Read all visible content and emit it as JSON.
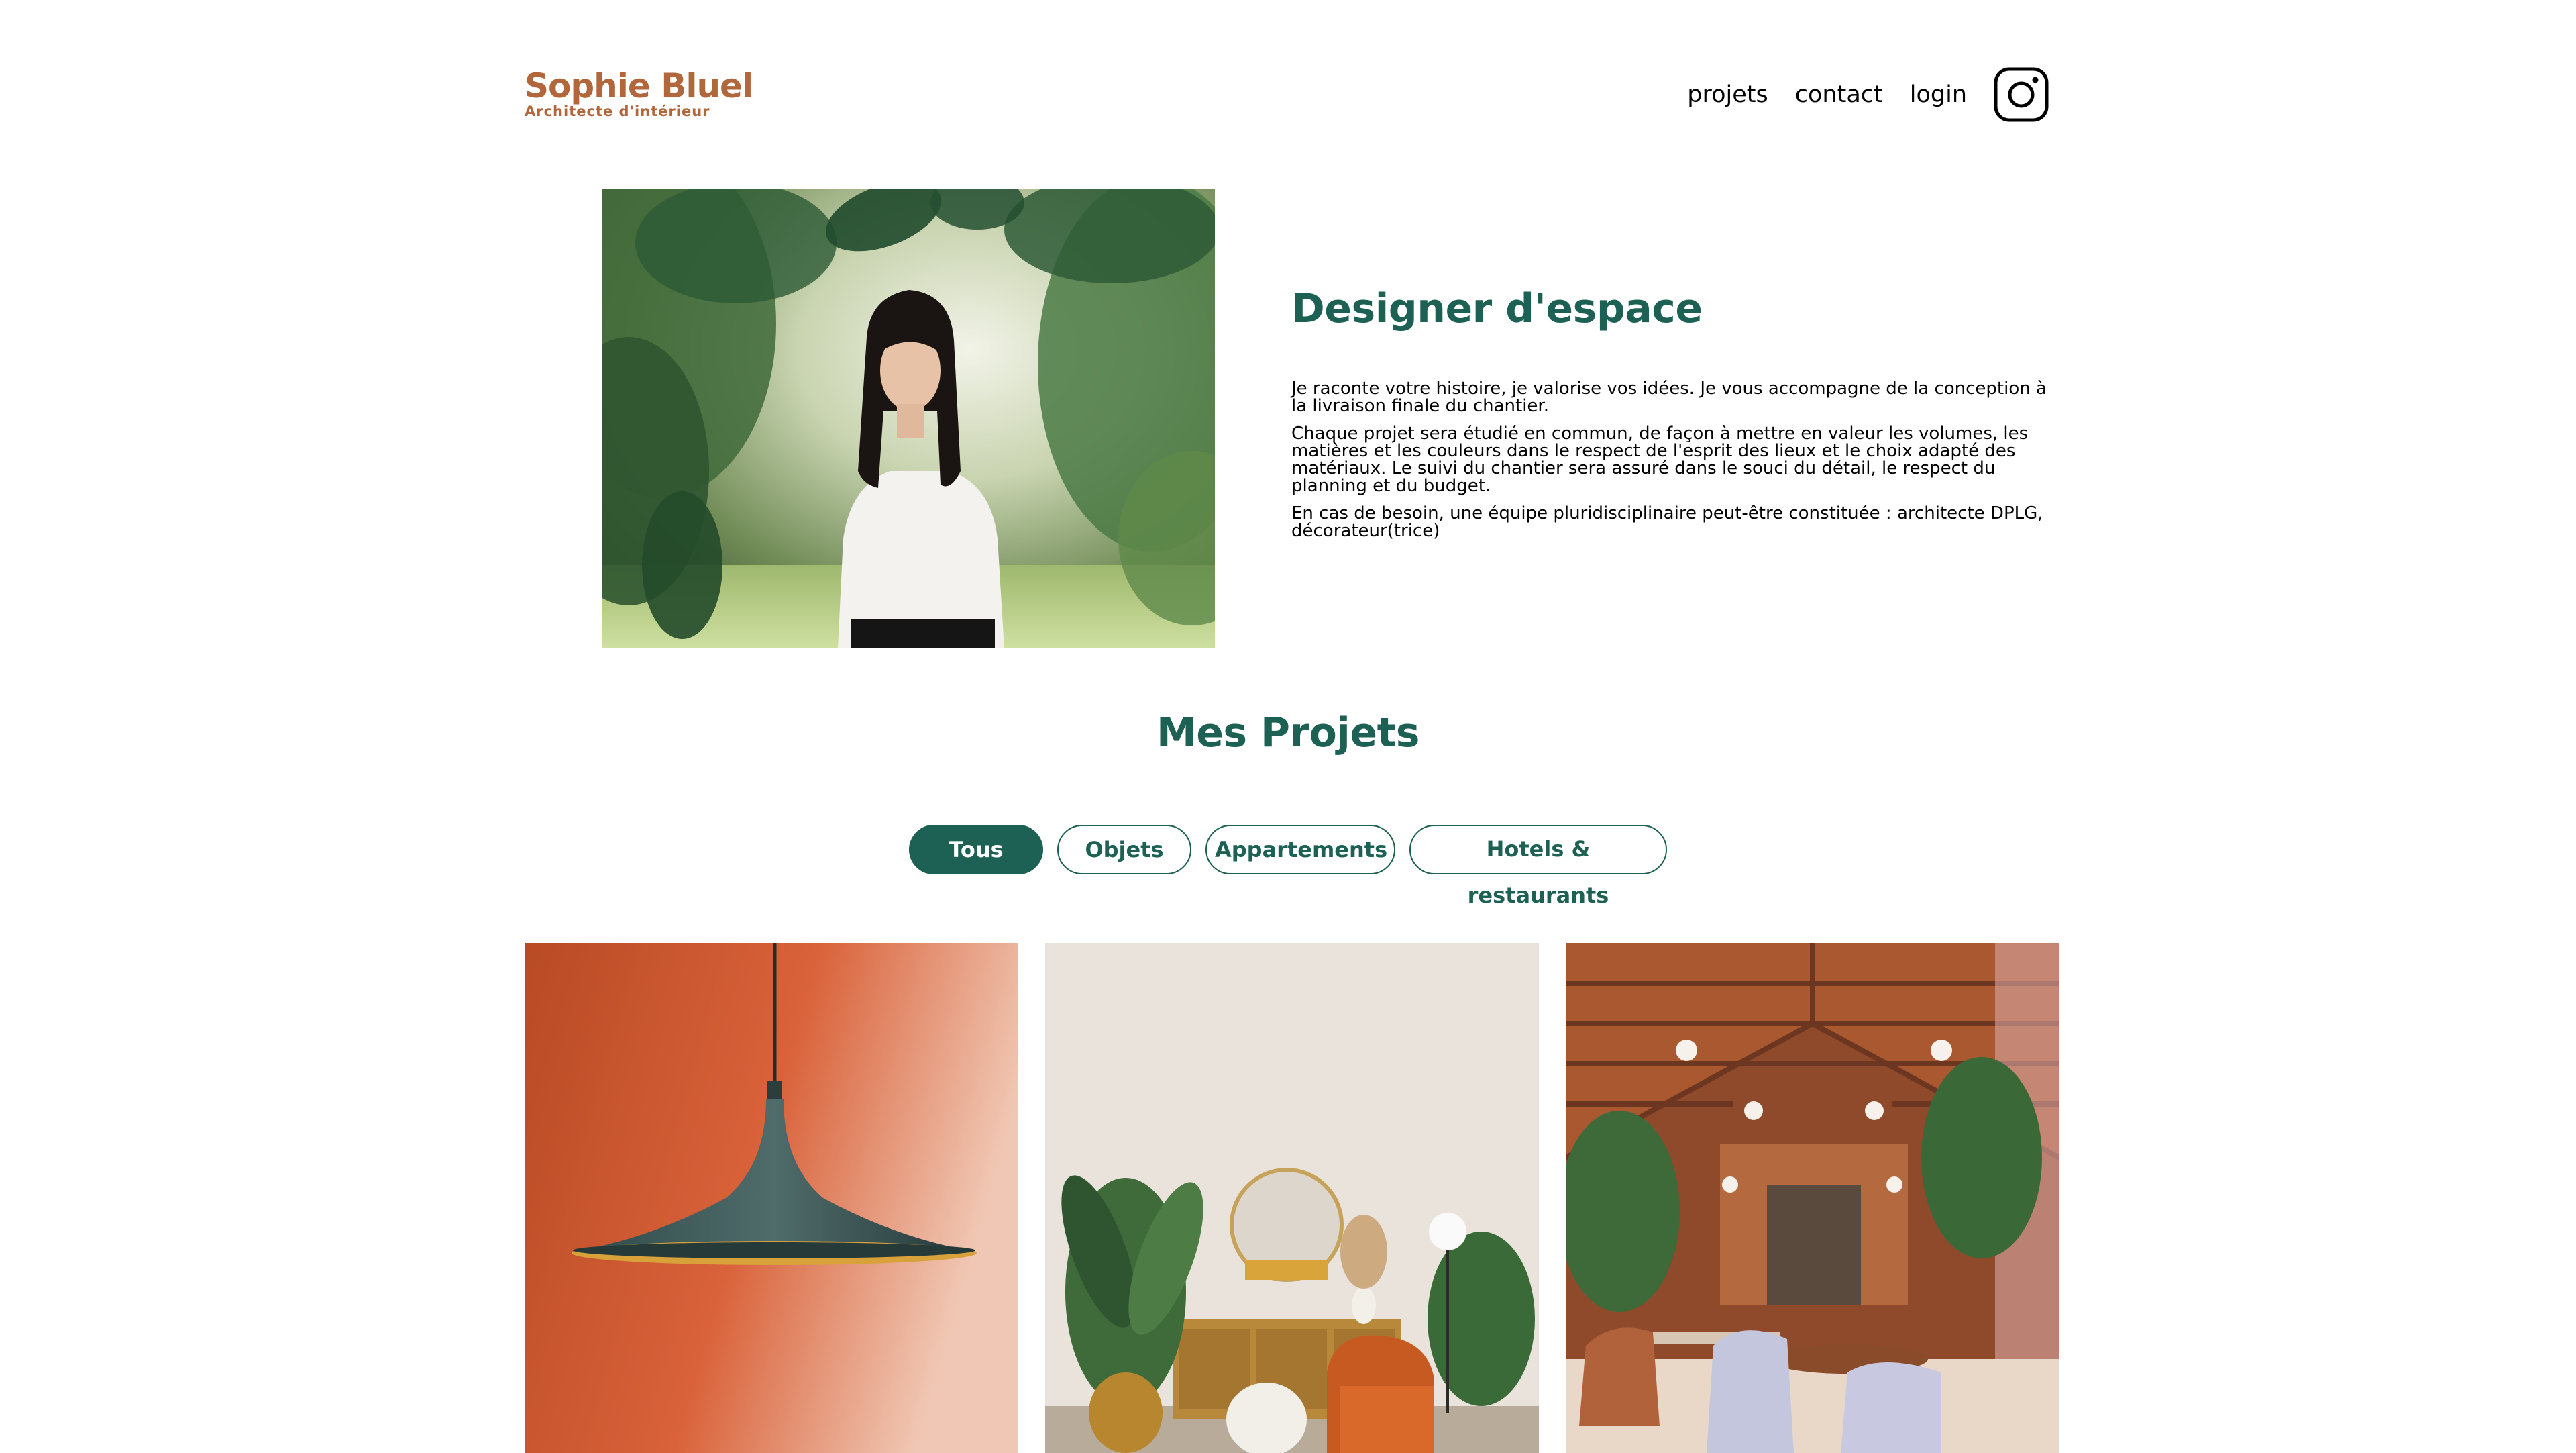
{
  "header": {
    "logo_name": "Sophie Bluel",
    "logo_subtitle": "Architecte d'intérieur",
    "nav": [
      {
        "label": "projets"
      },
      {
        "label": "contact"
      },
      {
        "label": "login"
      }
    ],
    "instagram_icon": "instagram-icon"
  },
  "intro": {
    "title": "Designer d'espace",
    "paragraphs": [
      "Je raconte votre histoire, je valorise vos idées. Je vous accompagne de la conception à la livraison finale du chantier.",
      "Chaque projet sera étudié en commun, de façon à mettre en valeur les volumes, les matières et les couleurs dans le respect de l'esprit des lieux et le choix adapté des matériaux. Le suivi du chantier sera assuré dans le souci du détail, le respect du planning et du budget.",
      "En cas de besoin, une équipe pluridisciplinaire peut-être constituée : architecte DPLG, décorateur(trice)"
    ]
  },
  "projects": {
    "title": "Mes Projets",
    "filters": [
      {
        "label": "Tous",
        "active": true
      },
      {
        "label": "Objets",
        "active": false
      },
      {
        "label": "Appartements",
        "active": false
      },
      {
        "label": "Hotels & restaurants",
        "active": false
      }
    ]
  },
  "colors": {
    "brand_green": "#1D6154",
    "brand_copper": "#B1663C"
  }
}
